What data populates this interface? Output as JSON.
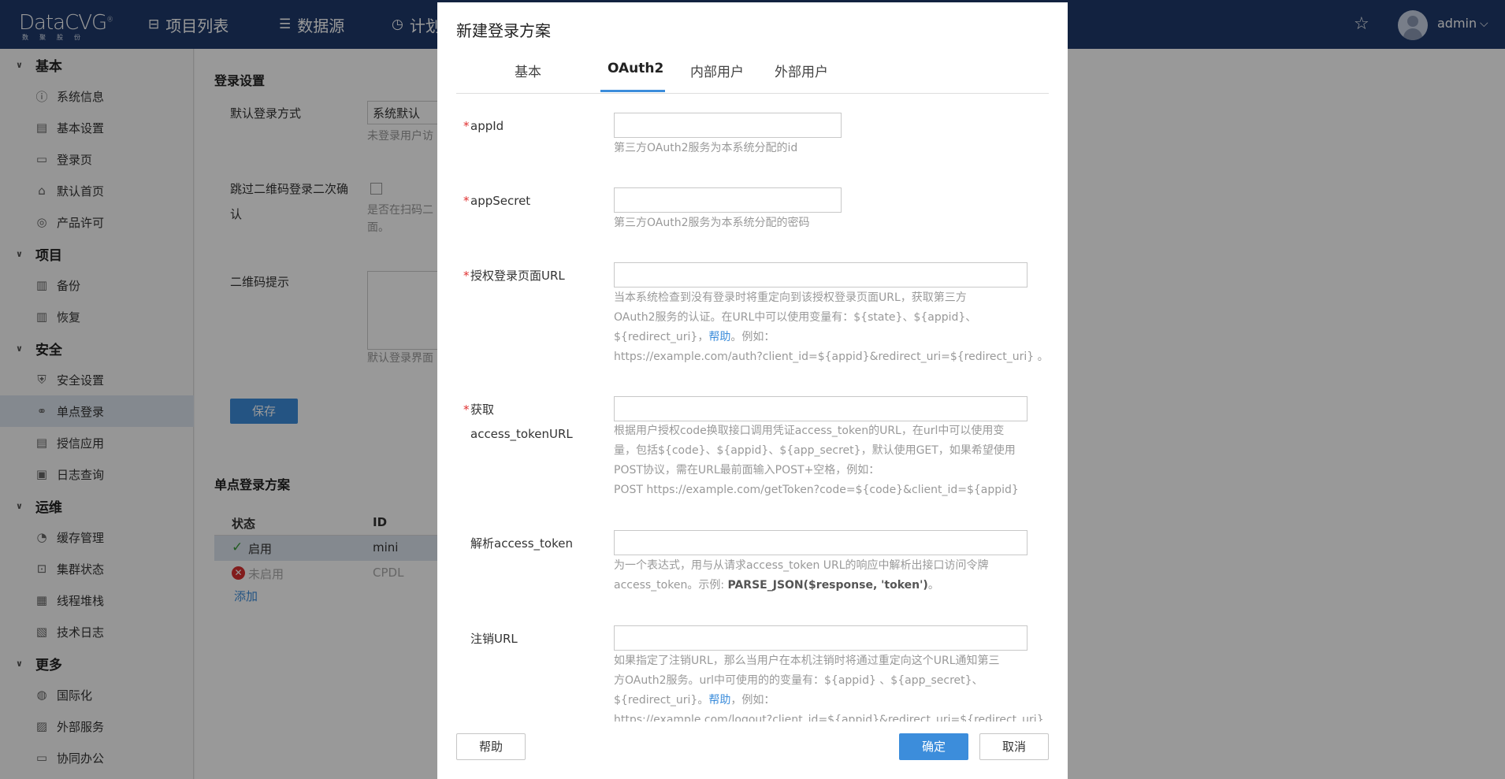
{
  "brand": {
    "name": "DataCVG",
    "reg": "®",
    "sub": "数聚股份"
  },
  "topnav": [
    {
      "icon": "briefcase-icon",
      "glyph": "⊟",
      "label": "项目列表"
    },
    {
      "icon": "database-icon",
      "glyph": "☰",
      "label": "数据源"
    },
    {
      "icon": "timer-icon",
      "glyph": "◷",
      "label": "计划"
    }
  ],
  "user": {
    "name": "admin"
  },
  "sidebar": {
    "groups": [
      {
        "label": "基本"
      },
      {
        "label": "项目"
      },
      {
        "label": "安全"
      },
      {
        "label": "运维"
      },
      {
        "label": "更多"
      }
    ],
    "items": [
      {
        "label": "系统信息",
        "glyph": "ⓘ",
        "icon": "info-icon"
      },
      {
        "label": "基本设置",
        "glyph": "▤",
        "icon": "settings-icon"
      },
      {
        "label": "登录页",
        "glyph": "▭",
        "icon": "monitor-icon"
      },
      {
        "label": "默认首页",
        "glyph": "⌂",
        "icon": "home-icon"
      },
      {
        "label": "产品许可",
        "glyph": "◎",
        "icon": "license-icon"
      },
      {
        "label": "备份",
        "glyph": "▥",
        "icon": "backup-icon"
      },
      {
        "label": "恢复",
        "glyph": "▥",
        "icon": "restore-icon"
      },
      {
        "label": "安全设置",
        "glyph": "⛨",
        "icon": "shield-icon"
      },
      {
        "label": "单点登录",
        "glyph": "⚭",
        "icon": "sso-icon"
      },
      {
        "label": "授信应用",
        "glyph": "▤",
        "icon": "trusted-app-icon"
      },
      {
        "label": "日志查询",
        "glyph": "▣",
        "icon": "log-search-icon"
      },
      {
        "label": "缓存管理",
        "glyph": "◔",
        "icon": "cache-icon"
      },
      {
        "label": "集群状态",
        "glyph": "⊡",
        "icon": "cluster-icon"
      },
      {
        "label": "线程堆栈",
        "glyph": "▦",
        "icon": "thread-icon"
      },
      {
        "label": "技术日志",
        "glyph": "▧",
        "icon": "tech-log-icon"
      },
      {
        "label": "国际化",
        "glyph": "◍",
        "icon": "globe-icon"
      },
      {
        "label": "外部服务",
        "glyph": "▨",
        "icon": "external-service-icon"
      },
      {
        "label": "协同办公",
        "glyph": "▭",
        "icon": "collab-icon"
      }
    ]
  },
  "page": {
    "login_settings_title": "登录设置",
    "default_login_label": "默认登录方式",
    "default_login_value": "系统默认",
    "default_login_hint": "未登录用户访",
    "skip_qr_label_1": "跳过二维码登录二次确",
    "skip_qr_label_2": "认",
    "skip_qr_hint_1": "是否在扫码二",
    "skip_qr_hint_2": "面。",
    "qr_tip_label": "二维码提示",
    "qr_tip_hint": "默认登录界面",
    "save_label": "保存",
    "sso_title": "单点登录方案",
    "table_headers": [
      "状态",
      "ID"
    ],
    "rows": [
      {
        "status": "启用",
        "id": "mini",
        "enabled": true
      },
      {
        "status": "未启用",
        "id": "CPDL",
        "enabled": false
      }
    ],
    "add_label": "添加"
  },
  "modal": {
    "title": "新建登录方案",
    "tabs": [
      "基本",
      "OAuth2",
      "内部用户",
      "外部用户"
    ],
    "active_tab": "OAuth2",
    "fields": {
      "appid": {
        "label": "appId",
        "value": "",
        "hint": "第三方OAuth2服务为本系统分配的id"
      },
      "appsecret": {
        "label": "appSecret",
        "value": "",
        "hint": "第三方OAuth2服务为本系统分配的密码"
      },
      "auth_url": {
        "label": "授权登录页面URL",
        "value": "",
        "hint_1": "当本系统检查到没有登录时将重定向到该授权登录页面URL，获取第三方",
        "hint_2": "OAuth2服务的认证。在URL中可以使用变量有：${state}、${appid}、",
        "hint_3a": "${redirect_uri}，",
        "hint_link": "帮助",
        "hint_3b": "。例如：",
        "hint_4": "https://example.com/auth?client_id=${appid}&redirect_uri=${redirect_uri} 。"
      },
      "token_url": {
        "label_1": "获取",
        "label_2": "access_tokenURL",
        "value": "",
        "hint_1": "根据用户授权code换取接口调用凭证access_token的URL，在url中可以使用变",
        "hint_2": "量，包括${code}、${appid}、${app_secret}，默认使用GET，如果希望使用",
        "hint_3": "POST协议，需在URL最前面输入POST+空格，例如：",
        "hint_4": "POST https://example.com/getToken?code=${code}&client_id=${appid}"
      },
      "parse_token": {
        "label": "解析access_token",
        "value": "",
        "hint_1": "为一个表达式，用与从请求access_token URL的响应中解析出接口访问令牌",
        "hint_2a": "access_token。示例: ",
        "hint_2b": "PARSE_JSON($response, 'token')",
        "hint_2c": "。"
      },
      "logout_url": {
        "label": "注销URL",
        "value": "",
        "hint_1": "如果指定了注销URL，那么当用户在本机注销时将通过重定向这个URL通知第三",
        "hint_2": "方OAuth2服务。url中可使用的的变量有：${appid} 、${app_secret}、",
        "hint_3a": "${redirect_uri}。",
        "hint_link": "帮助",
        "hint_3b": "，例如：",
        "hint_4": "https://example.com/logout?client_id=${appid}&redirect_uri=${redirect_uri}"
      }
    },
    "footer": {
      "help": "帮助",
      "ok": "确定",
      "cancel": "取消"
    }
  },
  "colors": {
    "topbar": "#1e3a6b",
    "accent": "#3c8ddb",
    "required": "#e03030"
  }
}
